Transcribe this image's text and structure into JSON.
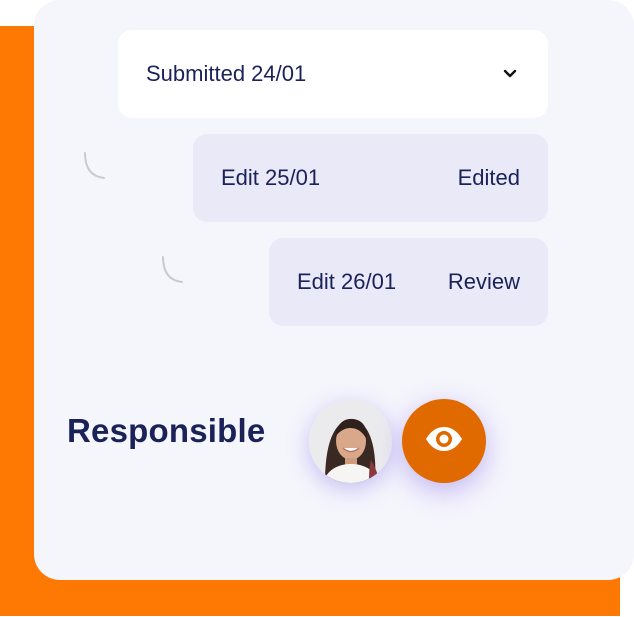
{
  "dropdown": {
    "label": "Submitted 24/01",
    "icon": "chevron-down-icon"
  },
  "edits": [
    {
      "label": "Edit 25/01",
      "status": "Edited"
    },
    {
      "label": "Edit 26/01",
      "status": "Review"
    }
  ],
  "responsible": {
    "label": "Responsible",
    "avatar": "avatar",
    "view_icon": "eye-icon"
  },
  "colors": {
    "accent": "#fe7904",
    "button": "#e06a00",
    "text": "#1a2258",
    "card": "#f5f5fc",
    "row": "#e9e9f7"
  }
}
